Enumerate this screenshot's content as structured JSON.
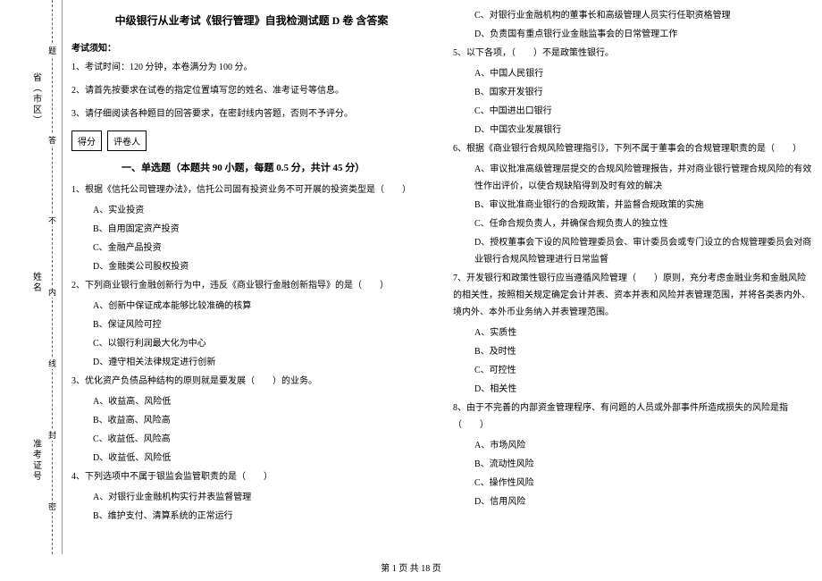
{
  "sidebar": {
    "field_province": "省（市区）",
    "field_name": "姓名",
    "field_ticket": "准考证号",
    "seal_labels": [
      "密",
      "封",
      "线",
      "内",
      "不",
      "答",
      "题"
    ]
  },
  "title": "中级银行从业考试《银行管理》自我检测试题 D 卷 含答案",
  "notice_head": "考试须知：",
  "notices": [
    "1、考试时间：120 分钟，本卷满分为 100 分。",
    "2、请首先按要求在试卷的指定位置填写您的姓名、准考证号等信息。",
    "3、请仔细阅读各种题目的回答要求，在密封线内答题，否则不予评分。"
  ],
  "score": {
    "score_label": "得分",
    "marker_label": "评卷人"
  },
  "section1_title": "一、单选题（本题共 90 小题，每题 0.5 分，共计 45 分）",
  "left_questions": [
    {
      "stem": "1、根据《信托公司管理办法》，信托公司固有投资业务不可开展的投资类型是（　　）",
      "opts": [
        "A、实业投资",
        "B、自用固定资产投资",
        "C、金融产品投资",
        "D、金融类公司股权投资"
      ]
    },
    {
      "stem": "2、下列商业银行金融创新行为中，违反《商业银行金融创新指导》的是（　　）",
      "opts": [
        "A、创新中保证成本能够比较准确的核算",
        "B、保证风险可控",
        "C、以银行利润最大化为中心",
        "D、遵守相关法律规定进行创新"
      ]
    },
    {
      "stem": "3、优化资产负债品种结构的原则就是要发展（　　）的业务。",
      "opts": [
        "A、收益高、风险低",
        "B、收益高、风险高",
        "C、收益低、风险高",
        "D、收益低、风险低"
      ]
    },
    {
      "stem": "4、下列选项中不属于银监会监管职责的是（　　）",
      "opts": [
        "A、对银行业金融机构实行并表监督管理",
        "B、维护支付、清算系统的正常运行"
      ]
    }
  ],
  "right_top_opts": [
    "C、对银行业金融机构的董事长和高级管理人员实行任职资格管理",
    "D、负责国有重点银行业金融监事会的日常管理工作"
  ],
  "right_questions": [
    {
      "stem": "5、以下各项，（　　）不是政策性银行。",
      "opts": [
        "A、中国人民银行",
        "B、国家开发银行",
        "C、中国进出口银行",
        "D、中国农业发展银行"
      ]
    },
    {
      "stem": "6、根据《商业银行合规风险管理指引》，下列不属于董事会的合规管理职责的是（　　）",
      "opts": [
        "A、审议批准高级管理层提交的合规风险管理报告，并对商业银行管理合规风险的有效性作出评价，以使合规缺陷得到及时有效的解决",
        "B、审议批准商业银行的合规政策，并监督合规政策的实施",
        "C、任命合规负责人，并确保合规负责人的独立性",
        "D、授权董事会下设的风险管理委员会、审计委员会或专门设立的合规管理委员会对商业银行合规风险管理进行日常监督"
      ]
    },
    {
      "stem": "7、开发银行和政策性银行应当遵循风险管理（　　）原则，充分考虑金融业务和金融风险的相关性，按照相关规定确定会计并表、资本并表和风险并表管理范围，并将各类表内外、境内外、本外币业务纳入并表管理范围。",
      "opts": [
        "A、实质性",
        "B、及时性",
        "C、可控性",
        "D、相关性"
      ]
    },
    {
      "stem": "8、由于不完善的内部资金管理程序、有问题的人员或外部事件所造成损失的风险是指（　　）",
      "opts": [
        "A、市场风险",
        "B、流动性风险",
        "C、操作性风险",
        "D、信用风险"
      ]
    }
  ],
  "footer": "第 1 页 共 18 页"
}
